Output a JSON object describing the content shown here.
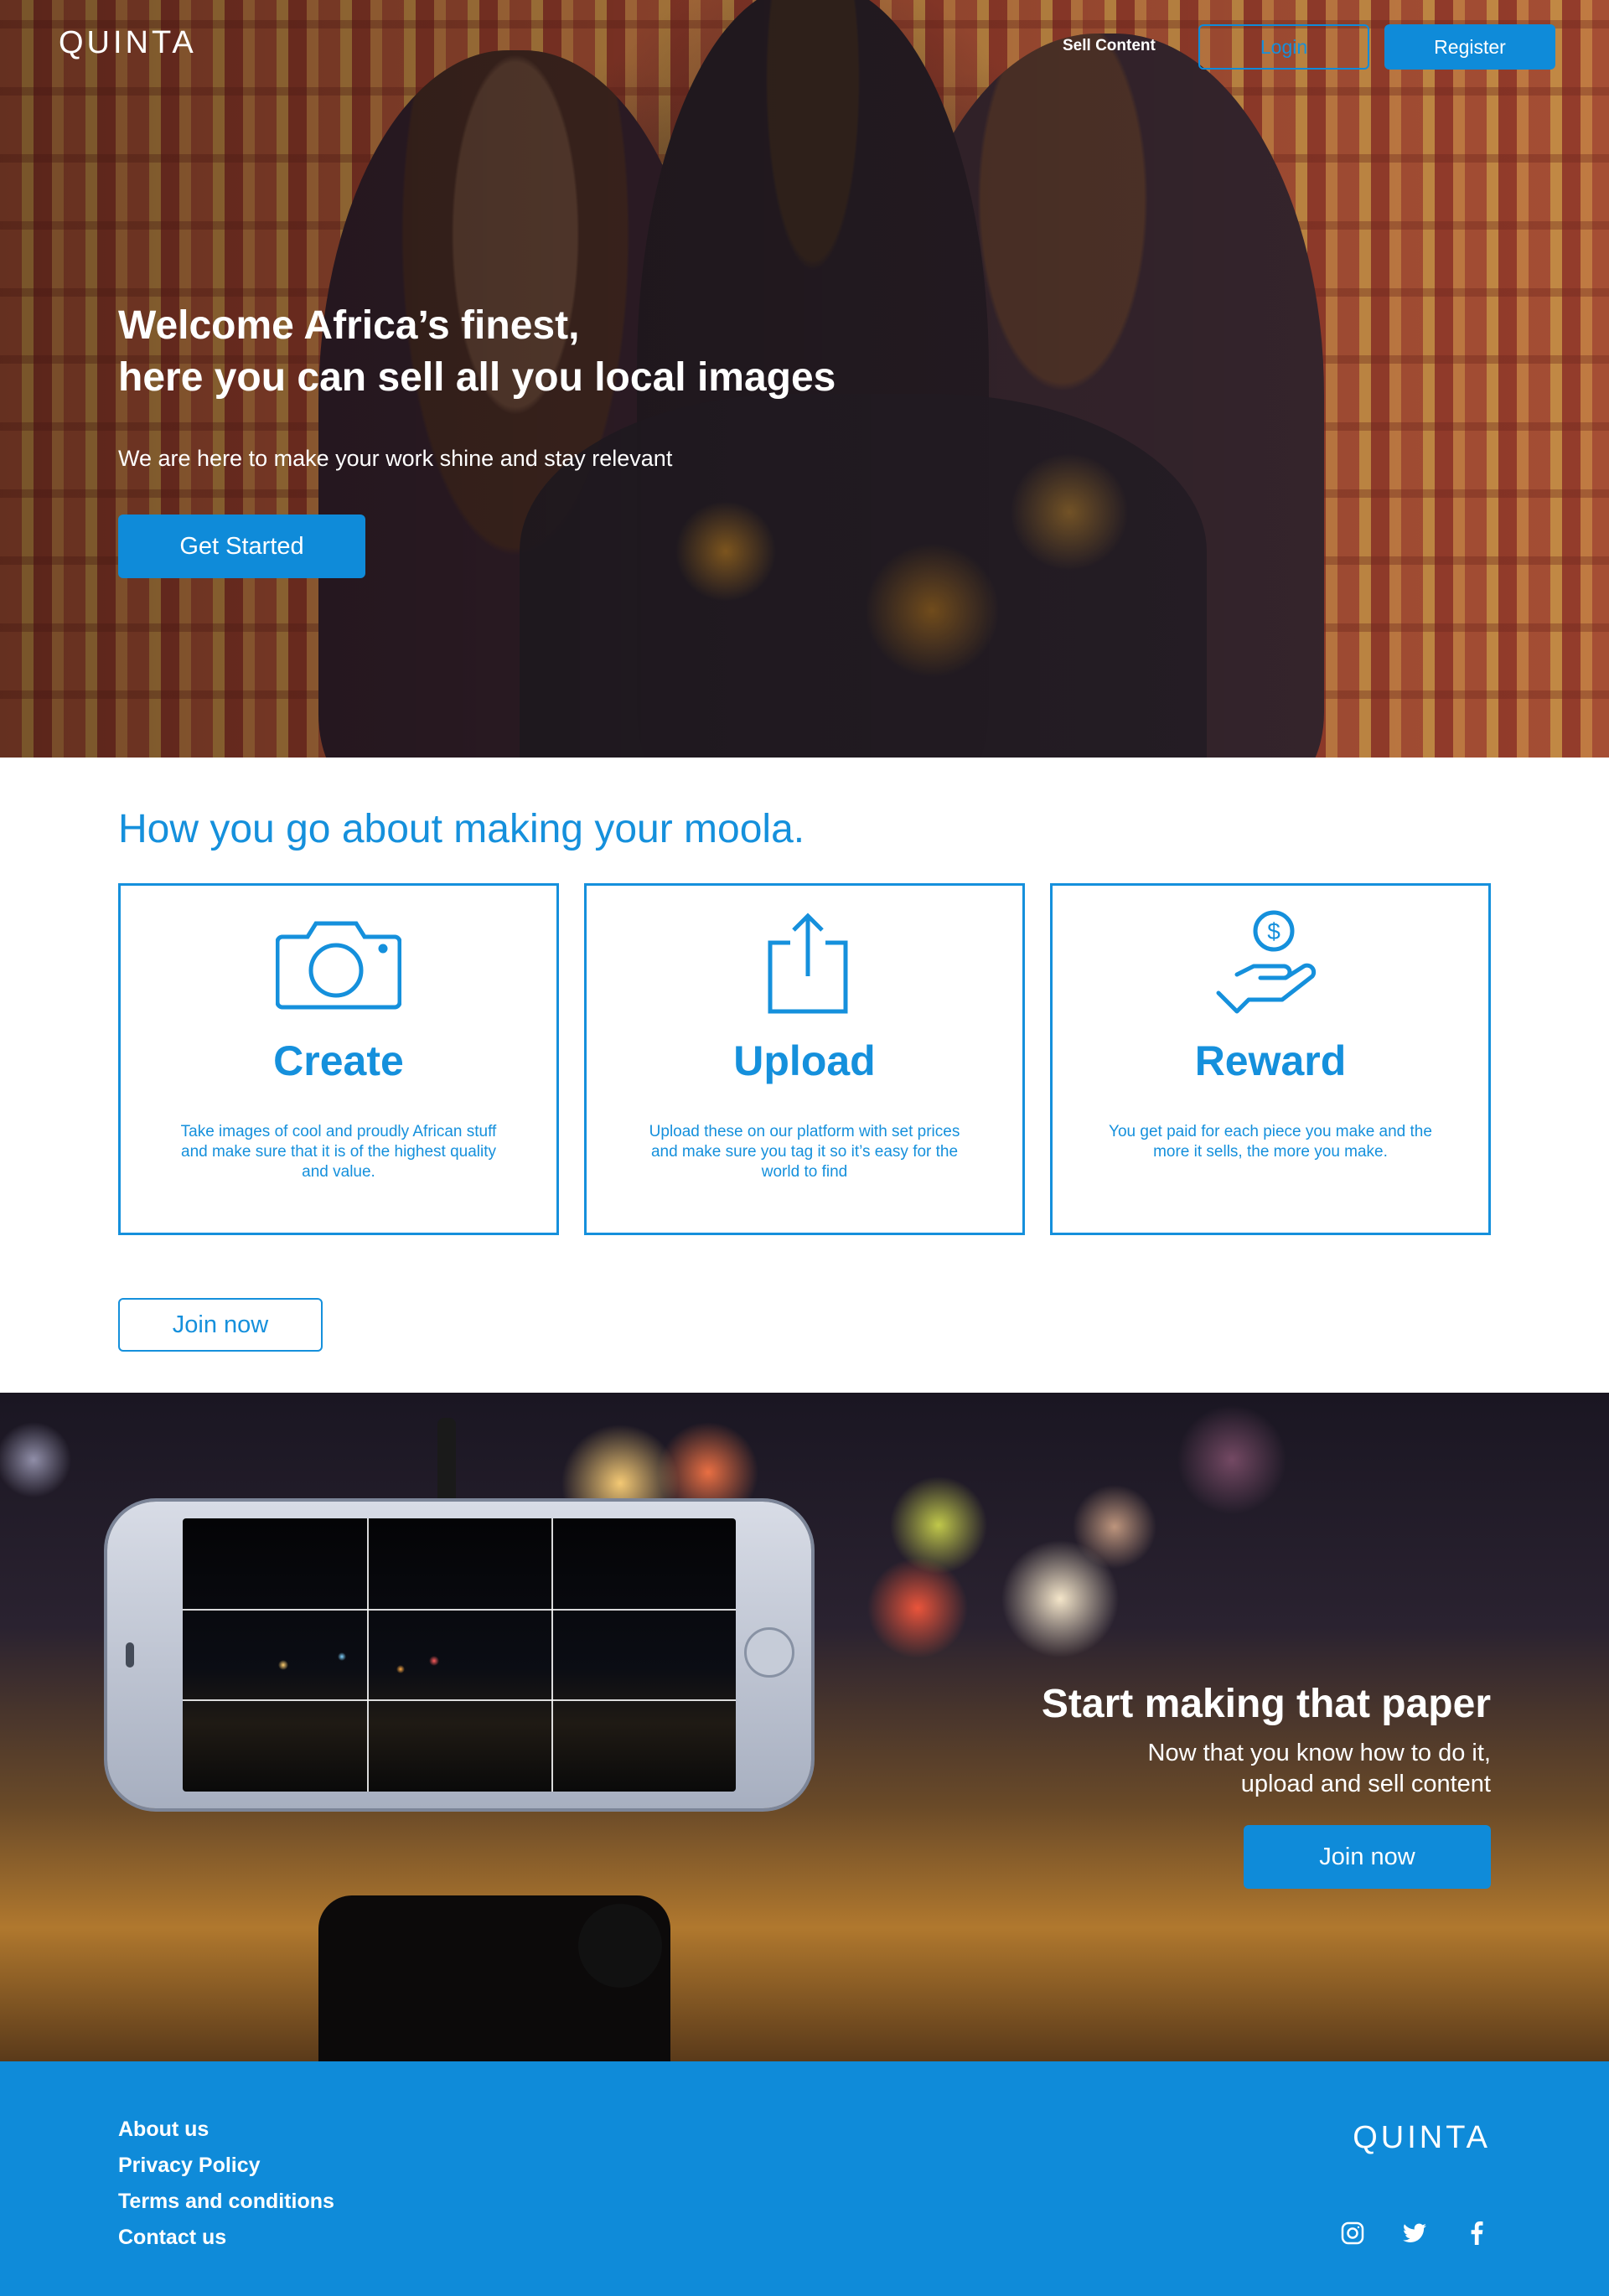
{
  "header": {
    "logo": "QUINTA",
    "nav_sell": "Sell Content",
    "login_label": "Login",
    "register_label": "Register"
  },
  "hero": {
    "title_line1": "Welcome Africa’s finest,",
    "title_line2": "here you can sell all you local images",
    "subtitle": "We are here to make your work shine and stay relevant",
    "cta_label": "Get Started"
  },
  "how": {
    "heading": "How you go about making your moola.",
    "cards": [
      {
        "icon": "camera-icon",
        "title": "Create",
        "desc": "Take images of cool and proudly African stuff and make sure that it is of the highest quality and value."
      },
      {
        "icon": "upload-icon",
        "title": "Upload",
        "desc": "Upload these on our platform with set prices and make sure you tag it so it’s easy for the world to find"
      },
      {
        "icon": "reward-hand-dollar-icon",
        "title": "Reward",
        "desc": "You get paid for each piece you make and the more it sells, the more you make."
      }
    ],
    "join_label": "Join now"
  },
  "banner": {
    "title": "Start making that paper",
    "subtitle_line1": "Now that you know how to do it,",
    "subtitle_line2": "upload and sell content",
    "cta_label": "Join now"
  },
  "footer": {
    "links": [
      "About us",
      "Privacy Policy",
      "Terms and conditions",
      "Contact us"
    ],
    "logo": "QUINTA",
    "socials": [
      "instagram-icon",
      "twitter-icon",
      "facebook-icon"
    ]
  },
  "colors": {
    "accent": "#0f8bd9",
    "accent_text": "#1590dc",
    "white": "#ffffff"
  }
}
